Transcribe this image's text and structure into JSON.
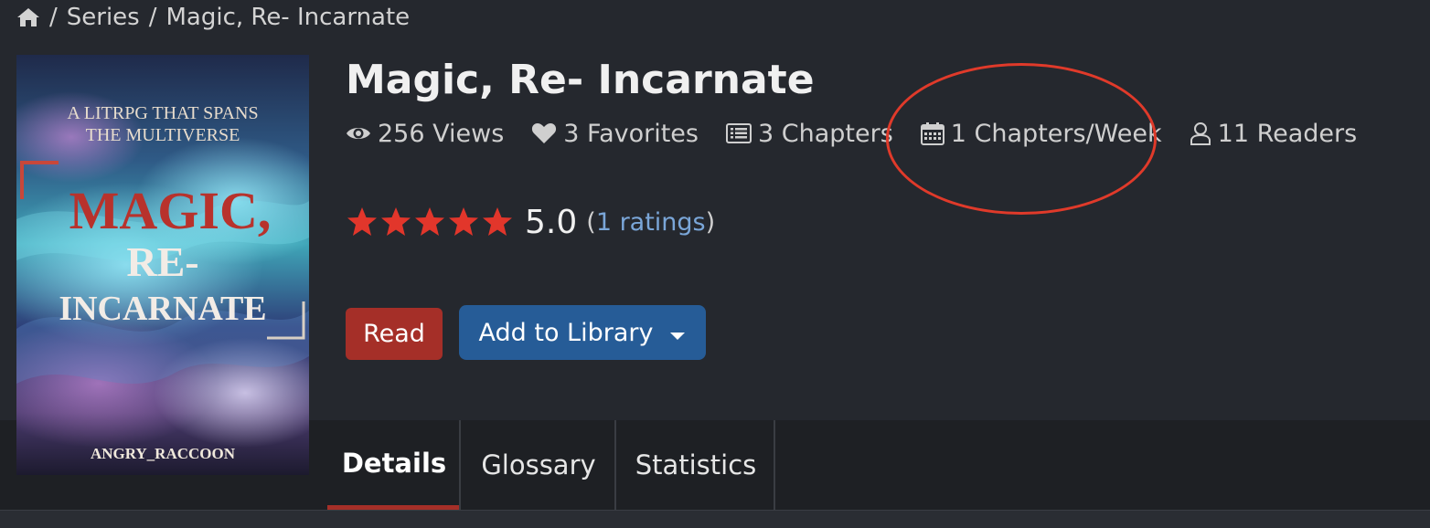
{
  "breadcrumb": {
    "home_icon": "home-icon",
    "separator": "/",
    "section": "Series",
    "current": "Magic, Re- Incarnate"
  },
  "cover": {
    "tagline_line1": "A LITRPG THAT SPANS",
    "tagline_line2": "THE MULTIVERSE",
    "title_line1": "MAGIC,",
    "title_line2": "RE-",
    "title_line3": "INCARNATE",
    "author": "ANGRY_RACCOON"
  },
  "title": "Magic, Re- Incarnate",
  "stats": {
    "views": {
      "icon": "eye-icon",
      "label": "256 Views"
    },
    "favorites": {
      "icon": "heart-icon",
      "label": "3 Favorites"
    },
    "chapters": {
      "icon": "list-icon",
      "label": "3 Chapters"
    },
    "frequency": {
      "icon": "calendar-icon",
      "label": "1 Chapters/Week"
    },
    "readers": {
      "icon": "user-icon",
      "label": "11 Readers"
    }
  },
  "rating": {
    "stars": 5,
    "score": "5.0",
    "open_paren": "(",
    "count_link": "1 ratings",
    "close_paren": ")"
  },
  "buttons": {
    "read": "Read",
    "add_to_library": "Add to Library"
  },
  "tabs": [
    {
      "label": "Details",
      "active": true
    },
    {
      "label": "Glossary",
      "active": false
    },
    {
      "label": "Statistics",
      "active": false
    }
  ],
  "colors": {
    "background": "#25282e",
    "read_button": "#a52f28",
    "library_button": "#265c97",
    "star": "#e2362b",
    "link": "#7aa6d8",
    "highlight_circle": "#e03a2a"
  }
}
